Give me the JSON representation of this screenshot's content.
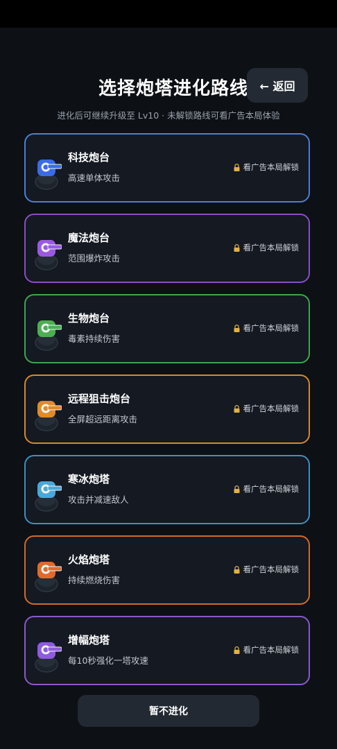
{
  "header": {
    "title": "选择炮塔进化路线",
    "back_label": "← 返回",
    "subtitle": "进化后可继续升级至 Lv10 · 未解锁路线可看广告本局体验"
  },
  "routes": [
    {
      "name": "科技炮台",
      "desc": "高速单体攻击",
      "unlock": "看广告本局解锁",
      "color": "#4a7fd8",
      "turret_color": "#3a6ce8",
      "icon": "tech-turret-icon"
    },
    {
      "name": "魔法炮台",
      "desc": "范围爆炸攻击",
      "unlock": "看广告本局解锁",
      "color": "#8a4ec4",
      "turret_color": "#9b59e0",
      "icon": "magic-turret-icon"
    },
    {
      "name": "生物炮台",
      "desc": "毒素持续伤害",
      "unlock": "看广告本局解锁",
      "color": "#3fa451",
      "turret_color": "#4caf50",
      "icon": "bio-turret-icon"
    },
    {
      "name": "远程狙击炮台",
      "desc": "全屏超远距离攻击",
      "unlock": "看广告本局解锁",
      "color": "#d8892b",
      "turret_color": "#e08a2a",
      "icon": "sniper-turret-icon"
    },
    {
      "name": "寒冰炮塔",
      "desc": "攻击并减速敌人",
      "unlock": "看广告本局解锁",
      "color": "#3f8fc2",
      "turret_color": "#4aa8d8",
      "icon": "ice-turret-icon"
    },
    {
      "name": "火焰炮塔",
      "desc": "持续燃烧伤害",
      "unlock": "看广告本局解锁",
      "color": "#d26b2a",
      "turret_color": "#e06a2a",
      "icon": "fire-turret-icon"
    },
    {
      "name": "增幅炮塔",
      "desc": "每10秒强化一塔攻速",
      "unlock": "看广告本局解锁",
      "color": "#8a5ac8",
      "turret_color": "#8e5ae0",
      "icon": "amplify-turret-icon"
    }
  ],
  "footer": {
    "skip_label": "暂不进化"
  }
}
